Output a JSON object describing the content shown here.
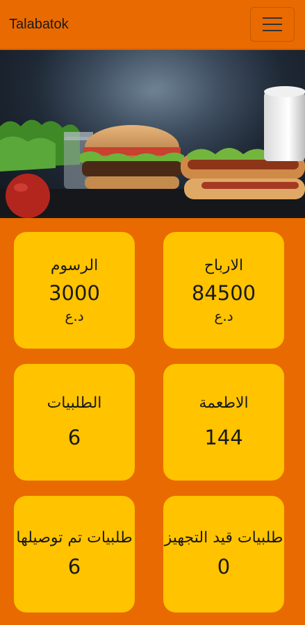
{
  "navbar": {
    "brand": "Talabatok",
    "menu_icon": "hamburger-menu-icon"
  },
  "banner": {
    "image": "burger-food-banner"
  },
  "stats": [
    {
      "title": "الرسوم",
      "value": "3000",
      "unit": "د.ع"
    },
    {
      "title": "الارباح",
      "value": "84500",
      "unit": "د.ع"
    },
    {
      "title": "الطلبيات",
      "value": "6"
    },
    {
      "title": "الاطعمة",
      "value": "144"
    },
    {
      "title": "طلبيات تم توصيلها",
      "value": "6"
    },
    {
      "title": "طلبيات قيد التجهيز",
      "value": "0"
    }
  ],
  "colors": {
    "background": "#e96a00",
    "card": "#ffc300"
  }
}
